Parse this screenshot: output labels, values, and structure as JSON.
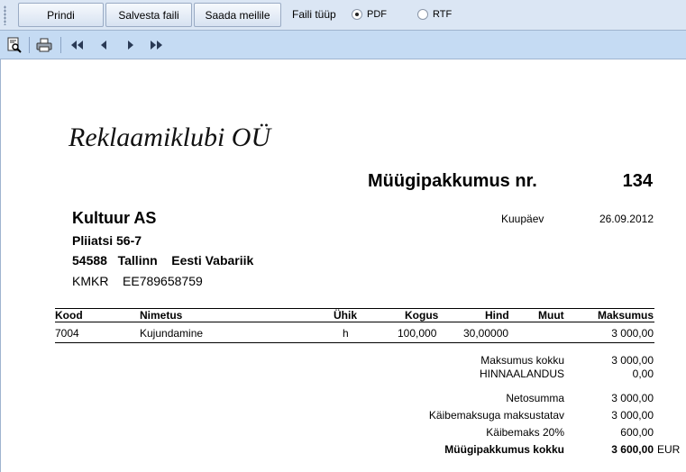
{
  "toolbar": {
    "print_label": "Prindi",
    "save_label": "Salvesta faili",
    "send_label": "Saada meilile",
    "file_type_label": "Faili tüüp",
    "file_types": [
      {
        "label": "PDF",
        "selected": true
      },
      {
        "label": "RTF",
        "selected": false
      }
    ]
  },
  "viewer": {
    "icons": [
      "preview-icon",
      "printer-icon",
      "first-page-icon",
      "prev-page-icon",
      "next-page-icon",
      "last-page-icon"
    ]
  },
  "document": {
    "company": "Reklaamiklubi OÜ",
    "title": "Müügipakkumus nr.",
    "number": "134",
    "client": {
      "name": "Kultuur AS",
      "street": "Pliiatsi 56-7",
      "postal": "54588",
      "city": "Tallinn",
      "country": "Eesti Vabariik",
      "vat_label": "KMKR",
      "vat_number": "EE789658759"
    },
    "date_label": "Kuupäev",
    "date": "26.09.2012",
    "table": {
      "headers": {
        "code": "Kood",
        "name": "Nimetus",
        "unit": "Ühik",
        "qty": "Kogus",
        "price": "Hind",
        "other": "Muut",
        "amount": "Maksumus"
      },
      "rows": [
        {
          "code": "7004",
          "name": "Kujundamine",
          "unit": "h",
          "qty": "100,000",
          "price": "30,00000",
          "other": "",
          "amount": "3 000,00"
        }
      ]
    },
    "totals": {
      "subtotal_label": "Maksumus kokku",
      "subtotal": "3 000,00",
      "discount_label": "HINNAALANDUS",
      "discount": "0,00",
      "net_label": "Netosumma",
      "net": "3 000,00",
      "vat_base_label": "Käibemaksuga maksustatav",
      "vat_base": "3 000,00",
      "vat_label": "Käibemaks 20%",
      "vat": "600,00",
      "grand_label": "Müügipakkumus kokku",
      "grand": "3 600,00",
      "currency": "EUR"
    }
  }
}
